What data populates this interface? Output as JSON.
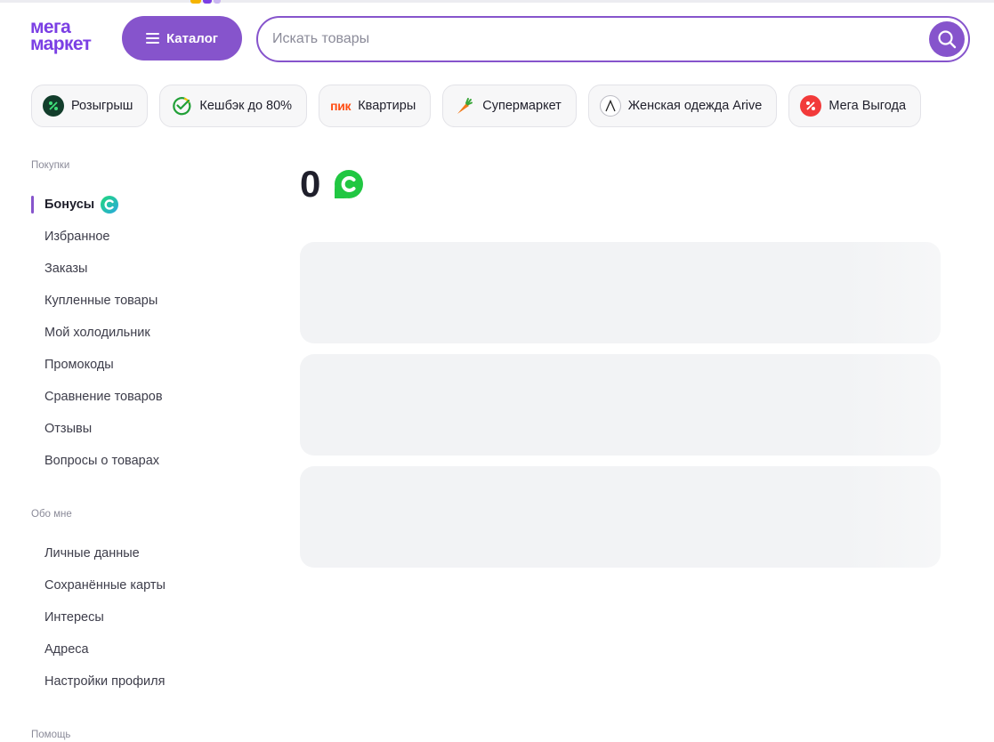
{
  "header": {
    "logo_line1": "мега",
    "logo_line2": "маркет",
    "catalog_label": "Каталог",
    "search_placeholder": "Искать товары"
  },
  "chips": [
    {
      "label": "Розыгрыш",
      "icon": "percent-dark-icon"
    },
    {
      "label": "Кешбэк до 80%",
      "icon": "sber-check-icon"
    },
    {
      "label": "Квартиры",
      "icon": "pik-logo",
      "logo_text": "пик"
    },
    {
      "label": "Супермаркет",
      "icon": "carrot-icon"
    },
    {
      "label": "Женская одежда Arive",
      "icon": "arive-logo-icon"
    },
    {
      "label": "Мега Выгода",
      "icon": "percent-red-icon"
    }
  ],
  "sidebar": {
    "purchases_title": "Покупки",
    "purchases": [
      "Бонусы",
      "Избранное",
      "Заказы",
      "Купленные товары",
      "Мой холодильник",
      "Промокоды",
      "Сравнение товаров",
      "Отзывы",
      "Вопросы о товарах"
    ],
    "about_title": "Обо мне",
    "about": [
      "Личные данные",
      "Сохранённые карты",
      "Интересы",
      "Адреса",
      "Настройки профиля"
    ],
    "help_title": "Помощь"
  },
  "main": {
    "bonus_balance": "0"
  },
  "colors": {
    "brand": "#8654cc",
    "logo": "#7b3fe4",
    "bonus_green": "#21c742",
    "placeholder_card": "#f2f3f5"
  }
}
